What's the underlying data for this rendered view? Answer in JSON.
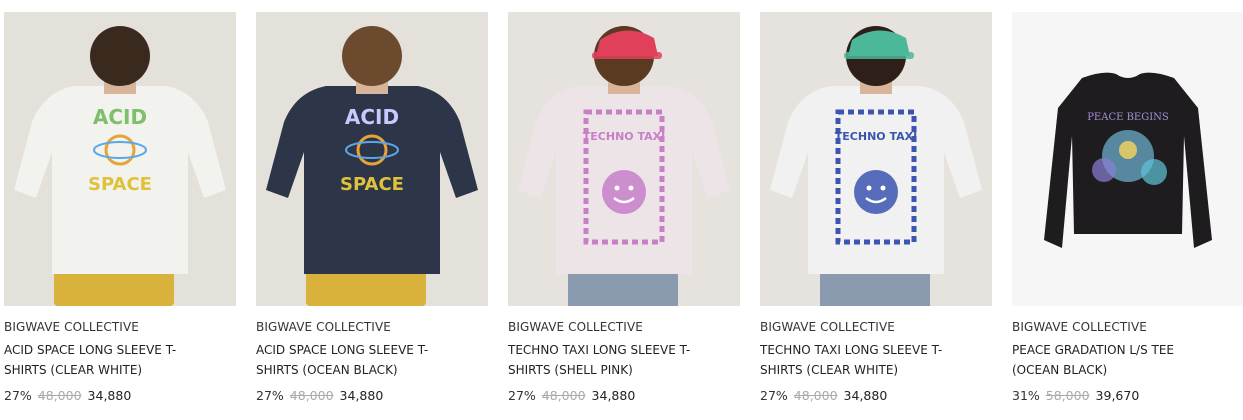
{
  "products": [
    {
      "brand": "BIGWAVE COLLECTIVE",
      "name": "ACID SPACE LONG SLEEVE T-SHIRTS (CLEAR WHITE)",
      "discount": "27%",
      "original_price": "48,000",
      "sale_price": "34,880",
      "image": {
        "background": "#e4e1db",
        "shirt": "#f2f2ef",
        "hair": "#3a2a1e",
        "shorts": "#d8b23a",
        "graphic": "#7fbf6a",
        "graphic_text": [
          "ACID",
          "SPACE"
        ]
      }
    },
    {
      "brand": "BIGWAVE COLLECTIVE",
      "name": "ACID SPACE LONG SLEEVE T-SHIRTS (OCEAN BLACK)",
      "discount": "27%",
      "original_price": "48,000",
      "sale_price": "34,880",
      "image": {
        "background": "#e4e1db",
        "shirt": "#2d3549",
        "hair": "#6b4a2e",
        "shorts": "#d8b23a",
        "graphic": "#c9c9ff",
        "graphic_text": [
          "ACID",
          "SPACE"
        ]
      }
    },
    {
      "brand": "BIGWAVE COLLECTIVE",
      "name": "TECHNO TAXI LONG SLEEVE T-SHIRTS (SHELL PINK)",
      "discount": "27%",
      "original_price": "48,000",
      "sale_price": "34,880",
      "image": {
        "background": "#e6e3de",
        "shirt": "#ece4e6",
        "hair": "#5b3a22",
        "cap": "#e0405a",
        "graphic": "#c87fc8",
        "graphic_text": [
          "TECHNO TAXI"
        ]
      }
    },
    {
      "brand": "BIGWAVE COLLECTIVE",
      "name": "TECHNO TAXI LONG SLEEVE T-SHIRTS (CLEAR WHITE)",
      "discount": "27%",
      "original_price": "48,000",
      "sale_price": "34,880",
      "image": {
        "background": "#e6e3de",
        "shirt": "#f1f1f1",
        "hair": "#2e2018",
        "cap": "#4bb89a",
        "graphic": "#3b55b0",
        "graphic_text": [
          "TECHNO TAXI"
        ]
      }
    },
    {
      "brand": "BIGWAVE COLLECTIVE",
      "name": "PEACE GRADATION L/S TEE (OCEAN BLACK)",
      "discount": "31%",
      "original_price": "58,000",
      "sale_price": "39,670",
      "image": {
        "background": "#f6f6f6",
        "shirt": "#1e1c1f",
        "graphic": "#6fb7d6",
        "graphic_text": [
          "PEACE BEGINS"
        ]
      }
    }
  ]
}
